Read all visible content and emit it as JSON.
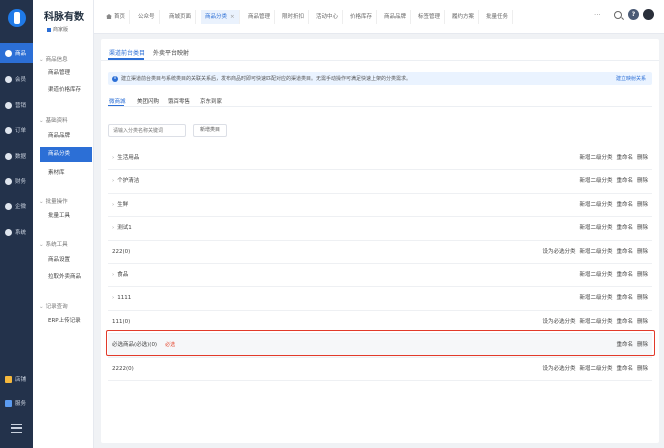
{
  "brand": {
    "name": "科脉有数",
    "sub": "商家版"
  },
  "rail": [
    {
      "label": "商品",
      "active": true
    },
    {
      "label": "会员",
      "active": false
    },
    {
      "label": "营销",
      "active": false
    },
    {
      "label": "订单",
      "active": false
    },
    {
      "label": "数据",
      "active": false
    },
    {
      "label": "财务",
      "active": false
    },
    {
      "label": "企微",
      "active": false
    },
    {
      "label": "系统",
      "active": false
    }
  ],
  "rail_bottom": [
    {
      "label": "店铺"
    },
    {
      "label": "服务"
    }
  ],
  "sidebar": {
    "groups": [
      {
        "title": "商品信息",
        "items": [
          {
            "label": "商品管理"
          },
          {
            "label": "渠道价格库存"
          }
        ]
      },
      {
        "title": "基础资料",
        "items": [
          {
            "label": "商品品牌"
          },
          {
            "label": "商品分类"
          },
          {
            "label": "素材库"
          }
        ]
      },
      {
        "title": "批量操作",
        "items": [
          {
            "label": "批量工具"
          }
        ]
      },
      {
        "title": "系统工具",
        "items": [
          {
            "label": "商品设置"
          },
          {
            "label": "拉取外卖商品"
          }
        ]
      },
      {
        "title": "记录查询",
        "items": [
          {
            "label": "ERP上传记录"
          }
        ]
      }
    ]
  },
  "topbar": {
    "tabs": [
      {
        "label": "首页",
        "active": false,
        "home": true
      },
      {
        "label": "公众号",
        "active": false
      },
      {
        "label": "商城页面",
        "active": false
      },
      {
        "label": "商品分类",
        "active": true,
        "closable": true
      },
      {
        "label": "商品管理",
        "active": false
      },
      {
        "label": "限时折扣",
        "active": false
      },
      {
        "label": "活动中心",
        "active": false
      },
      {
        "label": "价格库存",
        "active": false
      },
      {
        "label": "商品品牌",
        "active": false
      },
      {
        "label": "标签管理",
        "active": false
      },
      {
        "label": "履约方案",
        "active": false
      },
      {
        "label": "批量任务",
        "active": false
      }
    ],
    "more": "···",
    "close_glyph": "×"
  },
  "content": {
    "tabs": [
      {
        "label": "渠道前台类目",
        "active": true
      },
      {
        "label": "外卖平台映射",
        "active": false
      }
    ],
    "notice": {
      "text": "建立渠道前台类目与系统类目的关联关系后，发布商品时即可快速匹配对应的渠道类目。无需手动操作可满足快速上架的分类需求。",
      "link": "建立映射关系"
    },
    "channel_tabs": [
      {
        "label": "微商城",
        "active": true
      },
      {
        "label": "美团闪购",
        "active": false
      },
      {
        "label": "饿百零售",
        "active": false
      },
      {
        "label": "京东到家",
        "active": false
      }
    ],
    "search_placeholder": "请输入分类名称关键词",
    "new_button": "新增类目",
    "rows": [
      {
        "name": "生活用品",
        "expandable": true,
        "actions": [
          "新增二级分类",
          "重命名",
          "删除"
        ]
      },
      {
        "name": "个护清洁",
        "expandable": true,
        "actions": [
          "新增二级分类",
          "重命名",
          "删除"
        ]
      },
      {
        "name": "生鲜",
        "expandable": true,
        "actions": [
          "新增二级分类",
          "重命名",
          "删除"
        ]
      },
      {
        "name": "测试1",
        "expandable": true,
        "actions": [
          "新增二级分类",
          "重命名",
          "删除"
        ]
      },
      {
        "name": "222(0)",
        "expandable": false,
        "actions": [
          "设为必选分类",
          "新增二级分类",
          "重命名",
          "删除"
        ]
      },
      {
        "name": "食品",
        "expandable": true,
        "actions": [
          "新增二级分类",
          "重命名",
          "删除"
        ]
      },
      {
        "name": "1111",
        "expandable": true,
        "actions": [
          "新增二级分类",
          "重命名",
          "删除"
        ]
      },
      {
        "name": "111(0)",
        "expandable": false,
        "actions": [
          "设为必选分类",
          "新增二级分类",
          "重命名",
          "删除"
        ]
      },
      {
        "name": "必选商品(必选)(0)",
        "expandable": false,
        "tag": "必选",
        "highlighted": true,
        "actions": [
          "重命名",
          "删除"
        ]
      },
      {
        "name": "2222(0)",
        "expandable": false,
        "actions": [
          "设为必选分类",
          "新增二级分类",
          "重命名",
          "删除"
        ]
      }
    ]
  },
  "colors": {
    "accent": "#2c6fd6",
    "rail_bg": "#23324b",
    "highlight_border": "#e23a2a",
    "required_tag": "#e5482f"
  }
}
